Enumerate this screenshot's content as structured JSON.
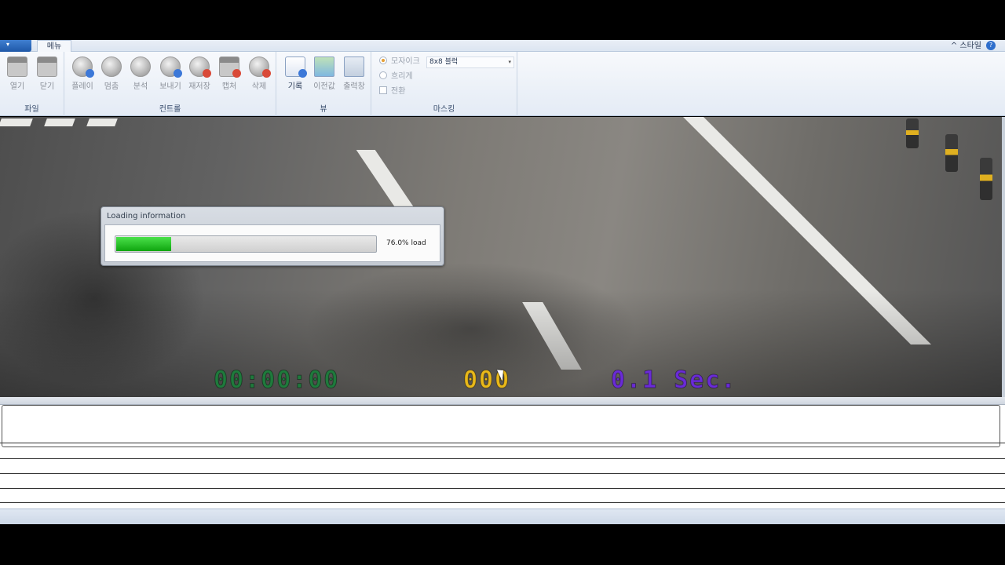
{
  "ribbon_tabs": {
    "app_button": "▾",
    "menu_tab": "메뉴",
    "style_menu": "스타일",
    "style_caret": "^",
    "help": "?"
  },
  "groups": {
    "file": {
      "label": "파일",
      "buttons": [
        {
          "label": "열기",
          "icon": "clapboard-icon"
        },
        {
          "label": "닫기",
          "icon": "clapboard-icon"
        }
      ]
    },
    "control": {
      "label": "컨트롤",
      "buttons": [
        {
          "label": "플레이",
          "icon": "film-reel-play-icon"
        },
        {
          "label": "멈춤",
          "icon": "film-reel-pause-icon"
        },
        {
          "label": "분석",
          "icon": "film-reel-analyze-icon"
        },
        {
          "label": "보내기",
          "icon": "film-reel-send-icon"
        },
        {
          "label": "재저장",
          "icon": "film-reel-resave-icon"
        },
        {
          "label": "캡처",
          "icon": "camera-icon"
        },
        {
          "label": "삭제",
          "icon": "film-reel-delete-icon"
        }
      ]
    },
    "view": {
      "label": "뷰",
      "buttons": [
        {
          "label": "기록",
          "icon": "record-person-icon"
        },
        {
          "label": "이전값",
          "icon": "picture-icon"
        },
        {
          "label": "출력창",
          "icon": "output-window-icon"
        }
      ]
    },
    "masking": {
      "label": "마스킹",
      "mosaic": "모자이크",
      "blur": "흐리게",
      "invert": "전환",
      "block_option": "8x8 블럭"
    }
  },
  "video": {
    "timecode": "00:00:00",
    "frame_counter": "000",
    "interval": "0.1 Sec.",
    "timecode_color": "#1f7a3c",
    "frame_color": "#e8b81a",
    "interval_color": "#6a2bd6"
  },
  "loading_dialog": {
    "title": "Loading information",
    "progress_percent": 76.0,
    "progress_text": "76.0% load"
  }
}
